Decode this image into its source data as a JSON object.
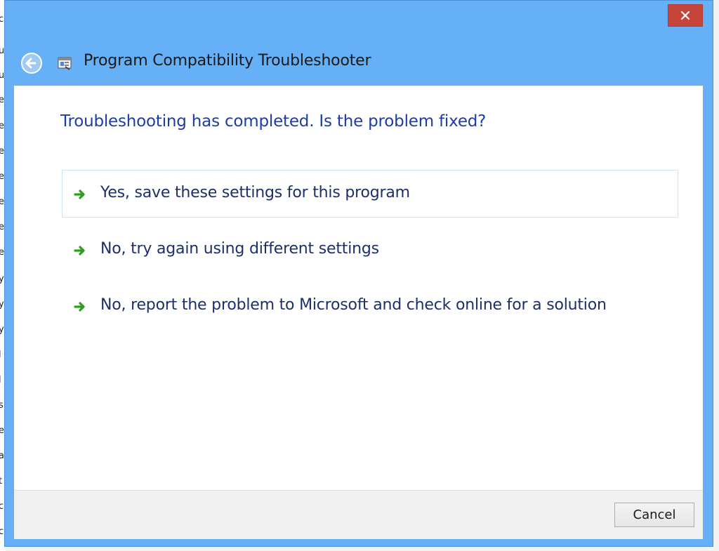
{
  "window": {
    "title": "Program Compatibility Troubleshooter",
    "close_label": "Close",
    "accent_color": "#65b0f7",
    "close_color": "#c7443a"
  },
  "question": "Troubleshooting has completed.  Is the problem fixed?",
  "options": [
    {
      "label": "Yes, save these settings for this program",
      "icon": "green-arrow-icon"
    },
    {
      "label": "No, try again using different settings",
      "icon": "green-arrow-icon"
    },
    {
      "label": "No, report the problem to Microsoft and check online for a solution",
      "icon": "green-arrow-icon"
    }
  ],
  "footer": {
    "cancel_label": "Cancel"
  }
}
